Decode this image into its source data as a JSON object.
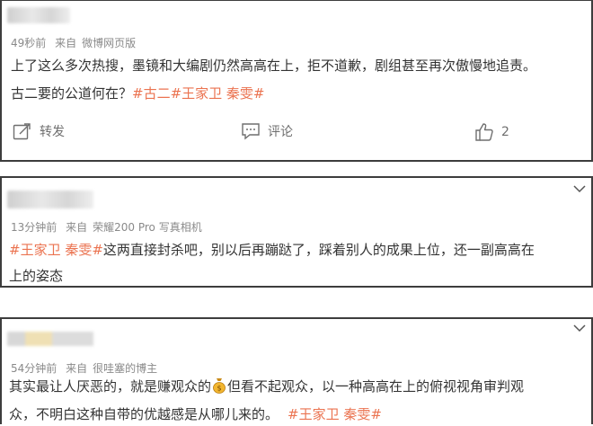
{
  "comments": [
    {
      "time": "49秒前",
      "source_prefix": "来自",
      "source": "微博网页版",
      "line1": "上了这么多次热搜，墨镜和大编剧仍然高高在上，拒不道歉，剧组甚至再次傲慢地追责。",
      "line2_text": "古二要的公道何在？",
      "tag1": "#古二",
      "tag2": "#王家卫 秦雯#",
      "actions": {
        "repost_label": "转发",
        "comment_label": "评论",
        "like_count": "2"
      }
    },
    {
      "time": "13分钟前",
      "source_prefix": "来自",
      "source": "荣耀200 Pro 写真相机",
      "tag": "#王家卫 秦雯#",
      "line1_text": "这两直接封杀吧，别以后再蹦跶了，踩着别人的成果上位，还一副高高在",
      "line2": "上的姿态"
    },
    {
      "time": "54分钟前",
      "source_prefix": "来自",
      "source": "很哇塞的博主",
      "line1_before": "其实最让人厌恶的，就是赚观众的",
      "line1_after": "但看不起观众，以一种高高在上的俯视视角审判观",
      "line2_text": "众，不明白这种自带的优越感是从哪儿来的。",
      "tag": "#王家卫 秦雯#"
    }
  ],
  "colors": {
    "tag": "#eb7350",
    "meta": "#8a8a8a",
    "text": "#333333",
    "border": "#3d3d3d"
  },
  "icons": [
    "repost-icon",
    "comment-icon",
    "like-icon",
    "chevron-down-icon",
    "money-bag-emoji"
  ]
}
